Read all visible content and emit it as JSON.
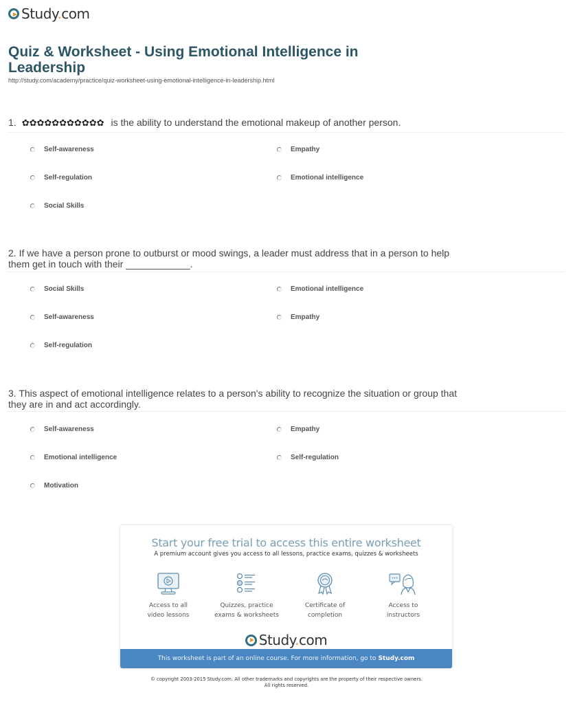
{
  "header": {
    "logo_text": "Study",
    "logo_dot": ".",
    "logo_suffix": "com",
    "title": "Quiz & Worksheet - Using Emotional Intelligence in Leadership",
    "url": "http://study.com/academy/practice/quiz-worksheet-using-emotional-intelligence-in-leadership.html"
  },
  "questions": [
    {
      "number": "1.",
      "hidden_term": "✿✿✿✿✿✿✿✿✿✿✿",
      "text": "is the ability to understand the emotional makeup of another person.",
      "options": [
        "Self-awareness",
        "Empathy",
        "Self-regulation",
        "Emotional intelligence",
        "Social Skills"
      ]
    },
    {
      "text": "2. If we have a person prone to outburst or mood swings, a leader must address that in a person to help them get in touch with their ____________.",
      "options": [
        "Social Skills",
        "Emotional intelligence",
        "Self-awareness",
        "Empathy",
        "Self-regulation"
      ]
    },
    {
      "text": "3. This aspect of emotional intelligence relates to a person's ability to recognize the situation or group that they are in and act accordingly.",
      "options": [
        "Self-awareness",
        "Empathy",
        "Emotional intelligence",
        "Self-regulation",
        "Motivation"
      ]
    }
  ],
  "promo": {
    "headline": "Start your free trial to access this entire worksheet",
    "subhead": "A premium account gives you access to all lessons, practice exams, quizzes & worksheets",
    "features": [
      {
        "icon": "video-lesson-icon",
        "line1": "Access to all",
        "line2": "video lessons"
      },
      {
        "icon": "quiz-list-icon",
        "line1": "Quizzes, practice",
        "line2": "exams & worksheets"
      },
      {
        "icon": "certificate-icon",
        "line1": "Certificate of",
        "line2": "completion"
      },
      {
        "icon": "instructor-icon",
        "line1": "Access to",
        "line2": "instructors"
      }
    ],
    "banner_text": "This worksheet is part of an online course. For more information, go to",
    "banner_link": "Study.com",
    "colors": {
      "banner": "#4a86c2",
      "headline": "#7a9fb3",
      "icon": "#5b8db0"
    }
  },
  "footer": {
    "copyright_line1": "© copyright 2003-2015 Study.com. All other trademarks and copyrights are the property of their respective owners.",
    "copyright_line2": "All rights reserved."
  }
}
